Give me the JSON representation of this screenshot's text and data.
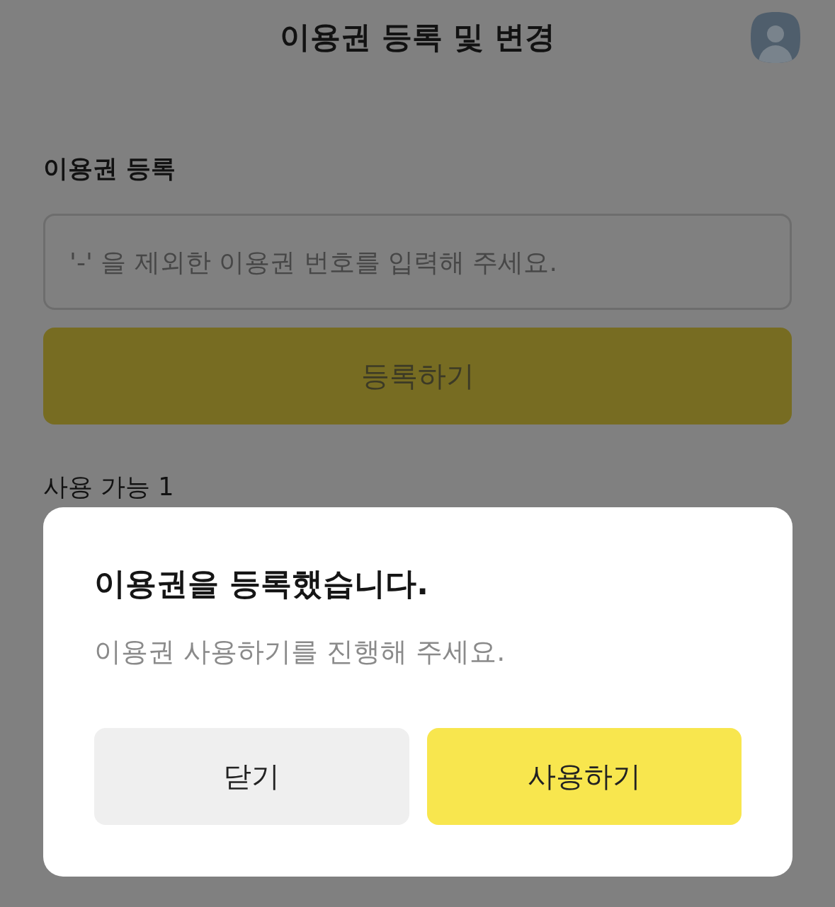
{
  "header": {
    "title": "이용권 등록 및 변경"
  },
  "register": {
    "heading": "이용권 등록",
    "input": {
      "placeholder": "'-' 을 제외한 이용권 번호를 입력해 주세요."
    },
    "button": {
      "label": "등록하기",
      "disabled": true
    }
  },
  "available": {
    "label": "사용 가능 1"
  },
  "dialog": {
    "title": "이용권을 등록했습니다.",
    "message": "이용권 사용하기를 진행해 주세요.",
    "buttons": [
      {
        "label": "닫기",
        "kind": "secondary"
      },
      {
        "label": "사용하기",
        "kind": "primary"
      }
    ]
  }
}
